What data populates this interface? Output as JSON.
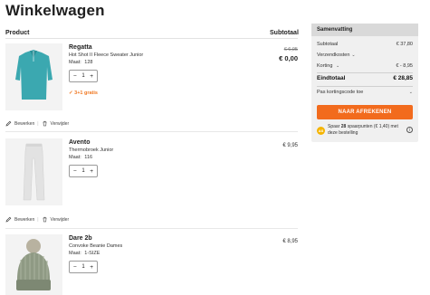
{
  "page": {
    "title": "Winkelwagen"
  },
  "columns": {
    "product": "Product",
    "subtotal": "Subtotaal"
  },
  "items": [
    {
      "brand": "Regatta",
      "description": "Hot Shot II Fleece Sweater Junior",
      "size_label": "Maat:",
      "size_value": "128",
      "quantity": "1",
      "price_old": "€ 6,95",
      "price": "€ 0,00",
      "promo": "3+1 gratis",
      "edit_label": "Bewerken",
      "remove_label": "Verwijder",
      "image_color": "#3ba8b0"
    },
    {
      "brand": "Avento",
      "description": "Thermobroek Junior",
      "size_label": "Maat:",
      "size_value": "116",
      "quantity": "1",
      "price": "€ 9,95",
      "edit_label": "Bewerken",
      "remove_label": "Verwijder",
      "image_color": "#e6e6e6"
    },
    {
      "brand": "Dare 2b",
      "description": "Convoke Beanie Dames",
      "size_label": "Maat:",
      "size_value": "1-SIZE",
      "quantity": "1",
      "price": "€ 8,95",
      "image_color": "#8f9a84"
    }
  ],
  "summary": {
    "title": "Samenvatting",
    "subtotal_label": "Subtotaal",
    "subtotal_value": "€ 37,80",
    "shipping_label": "Verzendkosten",
    "discount_label": "Korting",
    "discount_value": "€ - 8,95",
    "total_label": "Eindtotaal",
    "total_value": "€ 28,85",
    "coupon_label": "Pas kortingscode toe",
    "checkout_label": "NAAR AFREKENEN",
    "points_prefix": "Spaar",
    "points_count": "28",
    "points_suffix": "spaarpunten (€ 1,40) met deze bestelling",
    "accent_color": "#f26b1d"
  },
  "icons": {
    "minus": "−",
    "plus": "+",
    "check": "✓",
    "chevron": "⌄",
    "info": "i",
    "coin": "AS"
  }
}
